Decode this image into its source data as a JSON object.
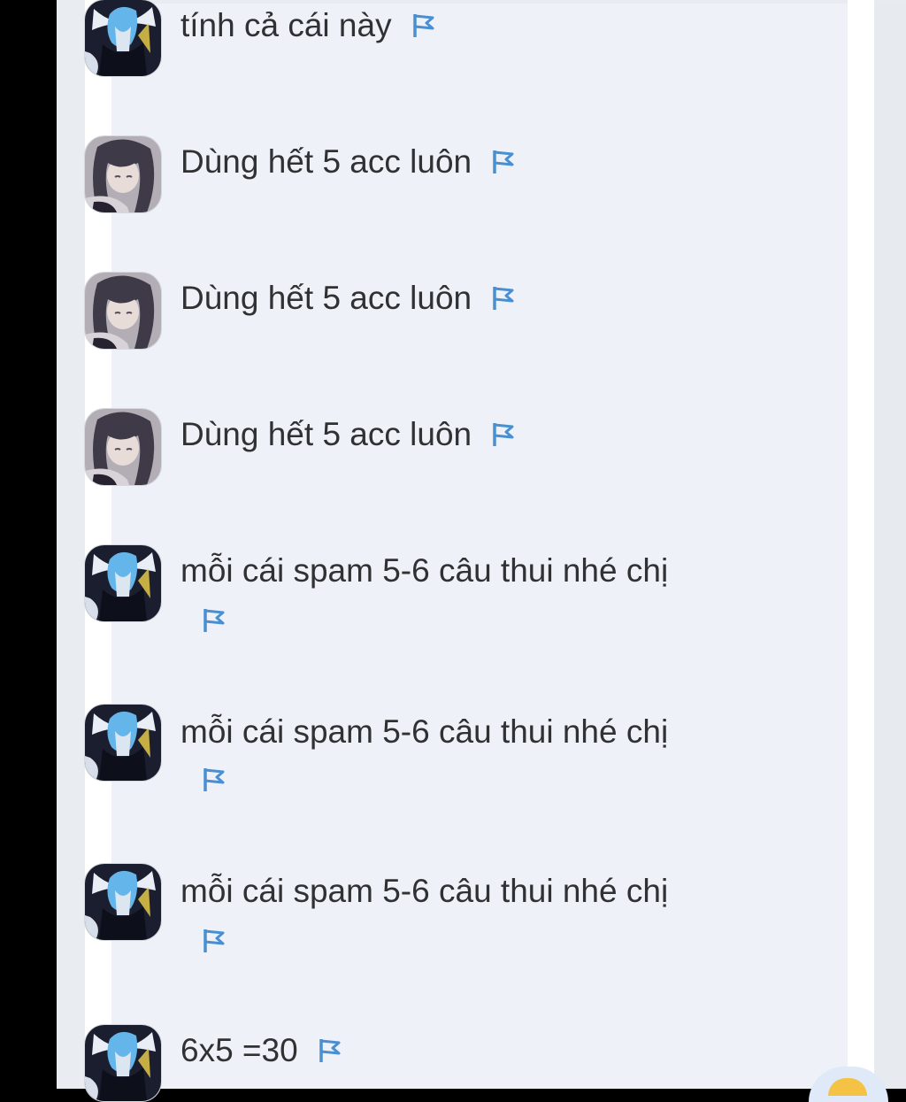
{
  "colors": {
    "flag": "#4a8fd1",
    "text": "#2f3133",
    "panel": "#eef2f8"
  },
  "messages": [
    {
      "avatar": "blue-hair-avatar",
      "text": "tính cả cái này",
      "flag": "flag-icon"
    },
    {
      "avatar": "dark-hair-girl-avatar",
      "text": "Dùng hết 5 acc luôn",
      "flag": "flag-icon"
    },
    {
      "avatar": "dark-hair-girl-avatar",
      "text": "Dùng hết 5 acc luôn",
      "flag": "flag-icon"
    },
    {
      "avatar": "dark-hair-girl-avatar",
      "text": "Dùng hết 5 acc luôn",
      "flag": "flag-icon"
    },
    {
      "avatar": "blue-hair-avatar",
      "text": "mỗi cái spam 5-6 câu thui nhé chị",
      "flag": "flag-icon"
    },
    {
      "avatar": "blue-hair-avatar",
      "text": "mỗi cái spam 5-6 câu thui nhé chị",
      "flag": "flag-icon"
    },
    {
      "avatar": "blue-hair-avatar",
      "text": "mỗi cái spam 5-6 câu thui nhé chị",
      "flag": "flag-icon"
    },
    {
      "avatar": "blue-hair-avatar",
      "text": "6x5 =30",
      "flag": "flag-icon"
    }
  ]
}
